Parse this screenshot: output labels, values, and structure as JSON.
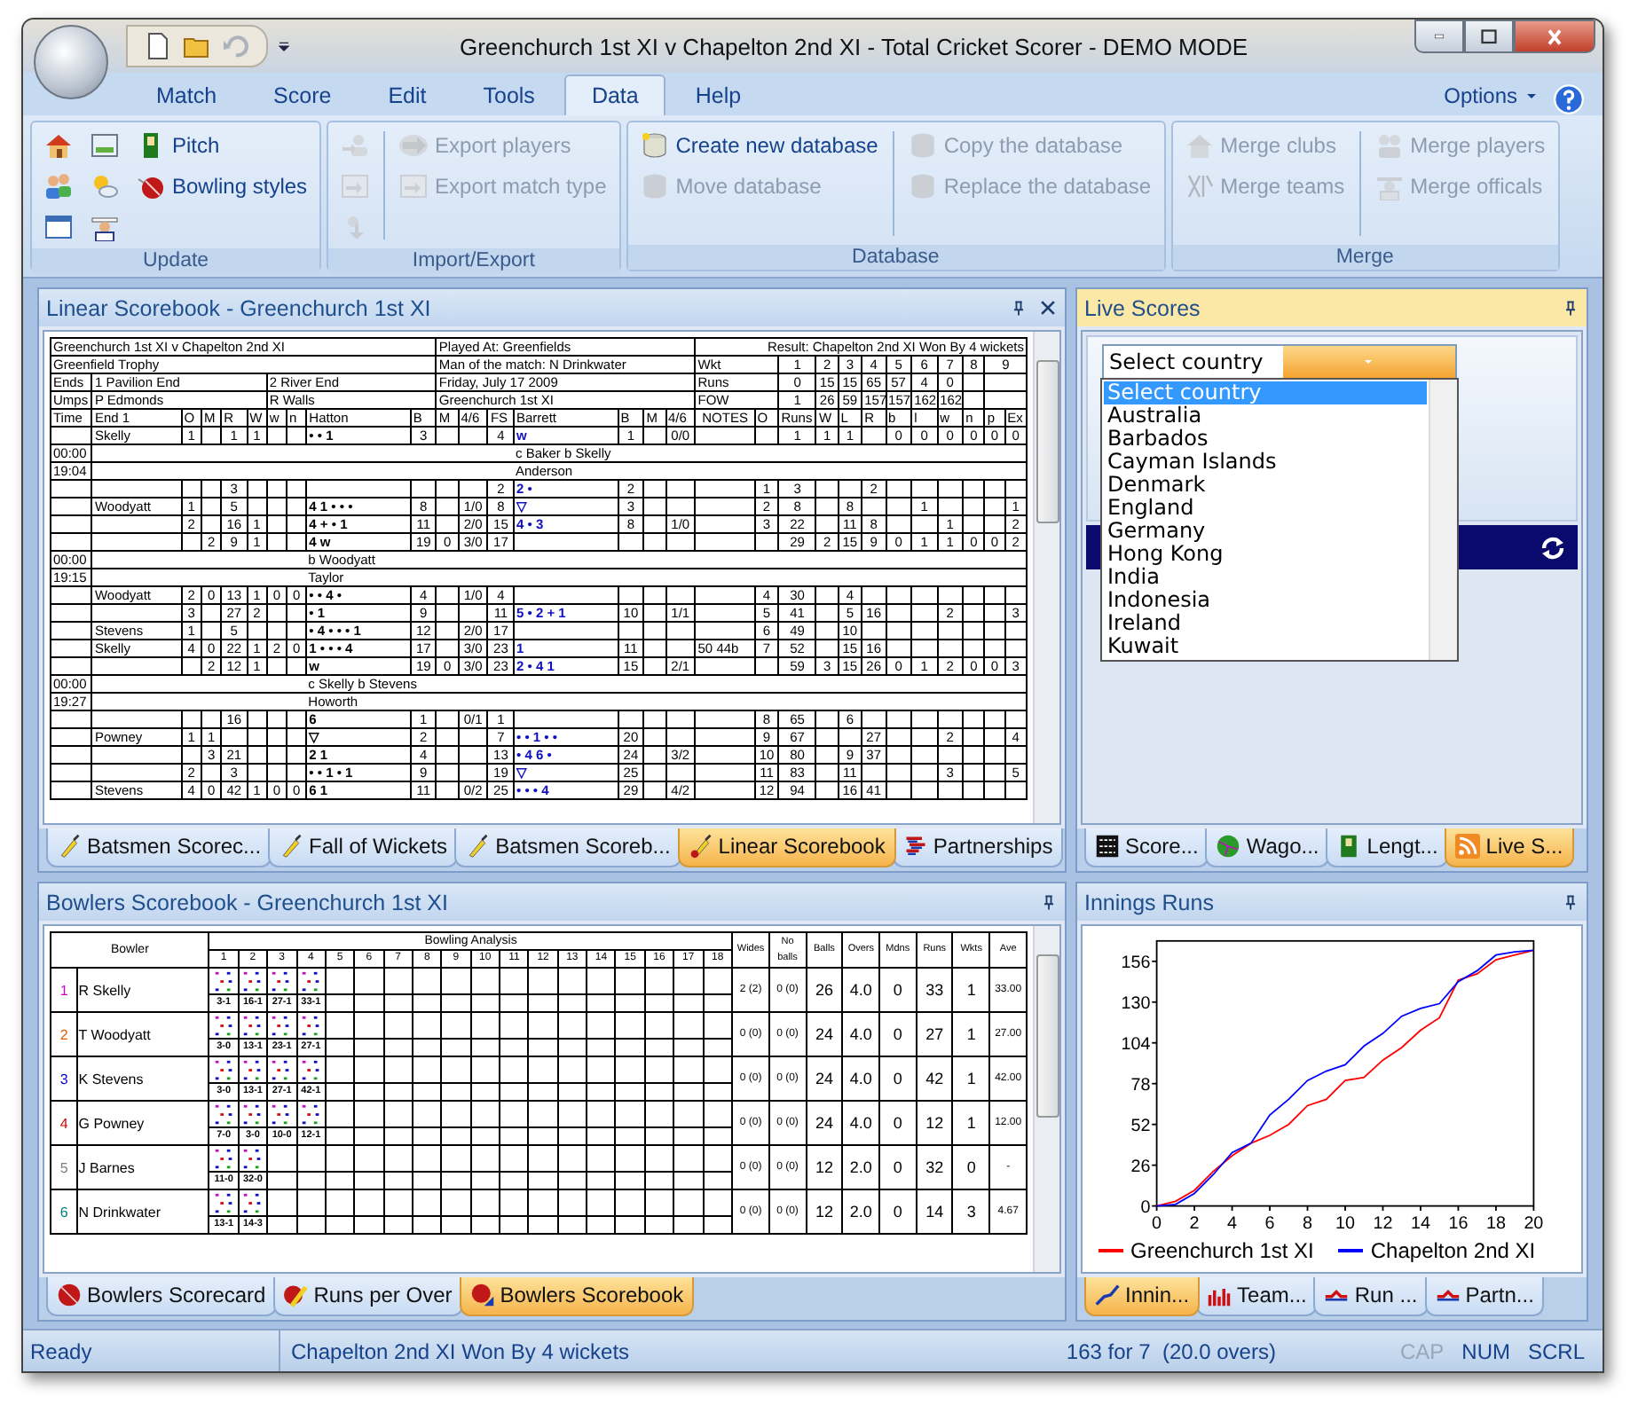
{
  "window": {
    "title": "Greenchurch 1st XI v Chapelton 2nd XI - Total Cricket Scorer - DEMO MODE"
  },
  "quick_access": [
    {
      "disabled": false
    },
    {
      "disabled": false
    },
    {
      "disabled": true
    }
  ],
  "ribbon_tabs": [
    {
      "label": "Match",
      "selected": false
    },
    {
      "label": "Score",
      "selected": false
    },
    {
      "label": "Edit",
      "selected": false
    },
    {
      "label": "Tools",
      "selected": false
    },
    {
      "label": "Data",
      "selected": true
    },
    {
      "label": "Help",
      "selected": false
    }
  ],
  "options": {
    "label": "Options"
  },
  "ribbon_groups": [
    {
      "label": "Update",
      "columns": [
        {
          "divider_before": false,
          "items": [
            {
              "disabled": false
            },
            {
              "disabled": false
            },
            {
              "disabled": false
            }
          ]
        },
        {
          "divider_before": false,
          "items": [
            {
              "disabled": false
            },
            {
              "disabled": false
            },
            {
              "disabled": false
            }
          ]
        },
        {
          "divider_before": false,
          "items": [
            {
              "label": "Pitch",
              "disabled": false
            },
            {
              "label": "Bowling styles",
              "disabled": false
            }
          ]
        }
      ]
    },
    {
      "label": "Import/Export",
      "columns": [
        {
          "divider_before": false,
          "items": [
            {
              "disabled": true
            },
            {
              "disabled": true
            },
            {
              "disabled": true
            }
          ]
        },
        {
          "divider_before": true,
          "items": [
            {
              "label": "Export players",
              "disabled": true
            },
            {
              "label": "Export match type",
              "disabled": true
            }
          ]
        }
      ]
    },
    {
      "label": "Database",
      "columns": [
        {
          "divider_before": false,
          "items": [
            {
              "label": "Create new database",
              "disabled": false
            },
            {
              "label": "Move database",
              "disabled": true
            }
          ]
        },
        {
          "divider_before": true,
          "items": [
            {
              "label": "Copy the database",
              "disabled": true
            },
            {
              "label": "Replace the database",
              "disabled": true
            }
          ]
        }
      ]
    },
    {
      "label": "Merge",
      "columns": [
        {
          "divider_before": false,
          "items": [
            {
              "label": "Merge clubs",
              "disabled": true
            },
            {
              "label": "Merge teams",
              "disabled": true
            }
          ]
        },
        {
          "divider_before": true,
          "items": [
            {
              "label": "Merge players",
              "disabled": true
            },
            {
              "label": "Merge officals",
              "disabled": true
            }
          ]
        }
      ]
    }
  ],
  "linear_scorebook": {
    "title": "Linear Scorebook - Greenchurch 1st XI",
    "info": {
      "match": "Greenchurch 1st XI v Chapelton 2nd XI",
      "played_at": "Played At: Greenfields",
      "result": "Result: Chapelton 2nd XI Won By 4 wickets",
      "competition": "Greenfield Trophy",
      "man_of_match": "Man of the match: N Drinkwater",
      "ends_label": "Ends",
      "end_1": "1 Pavilion End",
      "end_2": "2 River End",
      "date": "Friday, July 17 2009",
      "umps_label": "Umps",
      "ump_1": "P Edmonds",
      "ump_2": "R Walls",
      "batting_team": "Greenchurch 1st XI",
      "fall": [
        {
          "label": "Wkt",
          "values": [
            "1",
            "2",
            "3",
            "4",
            "5",
            "6",
            "7",
            "8",
            "9"
          ]
        },
        {
          "label": "Runs",
          "values": [
            "0",
            "15",
            "15",
            "65",
            "57",
            "4",
            "0"
          ]
        },
        {
          "label": "FOW",
          "values": [
            "1",
            "26",
            "59",
            "157",
            "157",
            "162",
            "162"
          ]
        }
      ]
    },
    "columns": [
      "Time",
      "End 1",
      "O",
      "M",
      "R",
      "W",
      "w",
      "n",
      "Hatton",
      "B",
      "M",
      "4/6",
      "FS",
      "Barrett",
      "B",
      "M",
      "4/6",
      "NOTES",
      "O",
      "Runs",
      "W",
      "L",
      "R",
      "b",
      "l",
      "w",
      "n",
      "p",
      "Ex"
    ],
    "rows": [
      {
        "kind": "over",
        "cells": [
          null,
          "Skelly",
          "1",
          null,
          "1",
          "1",
          null,
          null,
          "• • 1",
          "3",
          null,
          null,
          "4",
          "w",
          "1",
          null,
          "0/0",
          null,
          null,
          "1",
          "1",
          "1",
          null,
          "0",
          "0",
          "0",
          "0",
          "0",
          "0"
        ]
      },
      {
        "kind": "right",
        "time": "00:00",
        "text": "c Baker b Skelly"
      },
      {
        "kind": "right",
        "time": "19:04",
        "text": "Anderson"
      },
      {
        "kind": "over",
        "cells": [
          null,
          null,
          null,
          null,
          "3",
          null,
          null,
          null,
          null,
          null,
          null,
          null,
          "2",
          "2 •",
          "2",
          null,
          null,
          null,
          "1",
          "3",
          null,
          null,
          "2",
          null,
          null,
          null,
          null,
          null,
          null
        ]
      },
      {
        "kind": "over",
        "cells": [
          null,
          "Woodyatt",
          "1",
          null,
          "5",
          null,
          null,
          null,
          "4 1 • • •",
          "8",
          null,
          "1/0",
          "8",
          "▽",
          "3",
          null,
          null,
          null,
          "2",
          "8",
          null,
          "8",
          null,
          null,
          "1",
          null,
          null,
          null,
          "1"
        ]
      },
      {
        "kind": "over",
        "cells": [
          null,
          null,
          "2",
          null,
          "16",
          "1",
          null,
          null,
          "4 + • 1",
          "11",
          null,
          "2/0",
          "15",
          "4 • 3",
          "8",
          null,
          "1/0",
          null,
          "3",
          "22",
          null,
          "11",
          "8",
          null,
          null,
          "1",
          null,
          null,
          "2"
        ]
      },
      {
        "kind": "over",
        "cells": [
          null,
          null,
          null,
          "2",
          "9",
          "1",
          null,
          null,
          "4 w",
          "19",
          "0",
          "3/0",
          "17",
          null,
          null,
          null,
          null,
          null,
          null,
          "29",
          "2",
          "15",
          "9",
          "0",
          "1",
          "1",
          "0",
          "0",
          "2"
        ]
      },
      {
        "kind": "left",
        "time": "00:00",
        "text": "b Woodyatt"
      },
      {
        "kind": "left",
        "time": "19:15",
        "text": "Taylor"
      },
      {
        "kind": "over",
        "cells": [
          null,
          "Woodyatt",
          "2",
          "0",
          "13",
          "1",
          "0",
          "0",
          "• • 4 •",
          "4",
          null,
          "1/0",
          "4",
          null,
          null,
          null,
          null,
          null,
          "4",
          "30",
          null,
          "4",
          null,
          null,
          null,
          null,
          null,
          null,
          null
        ]
      },
      {
        "kind": "over",
        "cells": [
          null,
          null,
          "3",
          null,
          "27",
          "2",
          null,
          null,
          "• 1",
          "9",
          null,
          null,
          "11",
          "5 • 2 + 1",
          "10",
          null,
          "1/1",
          null,
          "5",
          "41",
          null,
          "5",
          "16",
          null,
          null,
          "2",
          null,
          null,
          "3"
        ]
      },
      {
        "kind": "over",
        "cells": [
          null,
          "Stevens",
          "1",
          null,
          "5",
          null,
          null,
          null,
          "• 4 • • • 1",
          "12",
          null,
          "2/0",
          "17",
          null,
          null,
          null,
          null,
          null,
          "6",
          "49",
          null,
          "10",
          null,
          null,
          null,
          null,
          null,
          null,
          null
        ]
      },
      {
        "kind": "over",
        "cells": [
          null,
          "Skelly",
          "4",
          "0",
          "22",
          "1",
          "2",
          "0",
          "1 • • • 4",
          "17",
          null,
          "3/0",
          "23",
          "1",
          "11",
          null,
          null,
          "50 44b",
          "7",
          "52",
          null,
          "15",
          "16",
          null,
          null,
          null,
          null,
          null,
          null
        ]
      },
      {
        "kind": "over",
        "cells": [
          null,
          null,
          null,
          "2",
          "12",
          "1",
          null,
          null,
          "w",
          "19",
          "0",
          "3/0",
          "23",
          "2 • 4 1",
          "15",
          null,
          "2/1",
          null,
          null,
          "59",
          "3",
          "15",
          "26",
          "0",
          "1",
          "2",
          "0",
          "0",
          "3"
        ]
      },
      {
        "kind": "left",
        "time": "00:00",
        "text": "c Skelly b Stevens"
      },
      {
        "kind": "left",
        "time": "19:27",
        "text": "Howorth"
      },
      {
        "kind": "over",
        "cells": [
          null,
          null,
          null,
          null,
          "16",
          null,
          null,
          null,
          "6",
          "1",
          null,
          "0/1",
          "1",
          null,
          null,
          null,
          null,
          null,
          "8",
          "65",
          null,
          "6",
          null,
          null,
          null,
          null,
          null,
          null,
          null
        ]
      },
      {
        "kind": "over",
        "cells": [
          null,
          "Powney",
          "1",
          "1",
          null,
          null,
          null,
          null,
          "▽",
          "2",
          null,
          null,
          "7",
          "• • 1 • •",
          "20",
          null,
          null,
          null,
          "9",
          "67",
          null,
          null,
          "27",
          null,
          null,
          "2",
          null,
          null,
          "4"
        ]
      },
      {
        "kind": "over",
        "cells": [
          null,
          null,
          null,
          "3",
          "21",
          null,
          null,
          null,
          "2 1",
          "4",
          null,
          null,
          "13",
          "• 4 6 •",
          "24",
          null,
          "3/2",
          null,
          "10",
          "80",
          null,
          "9",
          "37",
          null,
          null,
          null,
          null,
          null,
          null
        ]
      },
      {
        "kind": "over",
        "cells": [
          null,
          null,
          "2",
          null,
          "3",
          null,
          null,
          null,
          "• • 1 • 1",
          "9",
          null,
          null,
          "19",
          "▽",
          "25",
          null,
          null,
          null,
          "11",
          "83",
          null,
          "11",
          null,
          null,
          null,
          "3",
          null,
          null,
          "5"
        ]
      },
      {
        "kind": "over",
        "cells": [
          null,
          "Stevens",
          "4",
          "0",
          "42",
          "1",
          "0",
          "0",
          "6 1",
          "11",
          null,
          "0/2",
          "25",
          "• • • 4",
          "29",
          null,
          "4/2",
          null,
          "12",
          "94",
          null,
          "16",
          "41",
          null,
          null,
          null,
          null,
          null,
          null
        ]
      }
    ],
    "tabs": [
      {
        "label": "Batsmen Scorec...",
        "selected": false
      },
      {
        "label": "Fall of Wickets",
        "selected": false
      },
      {
        "label": "Batsmen Scoreb...",
        "selected": false
      },
      {
        "label": "Linear Scorebook",
        "selected": true
      },
      {
        "label": "Partnerships",
        "selected": false
      }
    ]
  },
  "live_scores": {
    "title": "Live Scores",
    "country_select": {
      "value": "Select country",
      "options": [
        {
          "label": "Select country",
          "selected": true
        },
        {
          "label": "Australia",
          "selected": false
        },
        {
          "label": "Barbados",
          "selected": false
        },
        {
          "label": "Cayman Islands",
          "selected": false
        },
        {
          "label": "Denmark",
          "selected": false
        },
        {
          "label": "England",
          "selected": false
        },
        {
          "label": "Germany",
          "selected": false
        },
        {
          "label": "Hong Kong",
          "selected": false
        },
        {
          "label": "India",
          "selected": false
        },
        {
          "label": "Indonesia",
          "selected": false
        },
        {
          "label": "Ireland",
          "selected": false
        },
        {
          "label": "Kuwait",
          "selected": false
        }
      ]
    },
    "tabs": [
      {
        "label": "Score...",
        "selected": false
      },
      {
        "label": "Wago...",
        "selected": false
      },
      {
        "label": "Lengt...",
        "selected": false
      },
      {
        "label": "Live S...",
        "selected": true
      }
    ]
  },
  "bowlers_scorebook": {
    "title": "Bowlers Scorebook - Greenchurch 1st XI",
    "bowler_heading": "Bowler",
    "analysis_heading": "Bowling Analysis",
    "overs": [
      "1",
      "2",
      "3",
      "4",
      "5",
      "6",
      "7",
      "8",
      "9",
      "10",
      "11",
      "12",
      "13",
      "14",
      "15",
      "16",
      "17",
      "18"
    ],
    "stat_headings": [
      "Wides",
      "No balls",
      "Balls",
      "Overs",
      "Mdns",
      "Runs",
      "Wkts",
      "Ave"
    ],
    "bowlers": [
      {
        "number": "1",
        "color": "#cc00cc",
        "name": "R Skelly",
        "over_totals": [
          "3-1",
          "16-1",
          "27-1",
          "33-1"
        ],
        "stats": [
          "2 (2)",
          "0 (0)",
          "26",
          "4.0",
          "0",
          "33",
          "1",
          "33.00"
        ]
      },
      {
        "number": "2",
        "color": "#e06000",
        "name": "T Woodyatt",
        "over_totals": [
          "3-0",
          "13-1",
          "23-1",
          "27-1"
        ],
        "stats": [
          "0 (0)",
          "0 (0)",
          "24",
          "4.0",
          "0",
          "27",
          "1",
          "27.00"
        ]
      },
      {
        "number": "3",
        "color": "#0000cc",
        "name": "K Stevens",
        "over_totals": [
          "3-0",
          "13-1",
          "27-1",
          "42-1"
        ],
        "stats": [
          "0 (0)",
          "0 (0)",
          "24",
          "4.0",
          "0",
          "42",
          "1",
          "42.00"
        ]
      },
      {
        "number": "4",
        "color": "#cc0000",
        "name": "G Powney",
        "over_totals": [
          "7-0",
          "3-0",
          "10-0",
          "12-1"
        ],
        "stats": [
          "0 (0)",
          "0 (0)",
          "24",
          "4.0",
          "0",
          "12",
          "1",
          "12.00"
        ]
      },
      {
        "number": "5",
        "color": "#808080",
        "name": "J Barnes",
        "over_totals": [
          "11-0",
          "32-0"
        ],
        "stats": [
          "0 (0)",
          "0 (0)",
          "12",
          "2.0",
          "0",
          "32",
          "0",
          "-"
        ]
      },
      {
        "number": "6",
        "color": "#008080",
        "name": "N Drinkwater",
        "over_totals": [
          "13-1",
          "14-3"
        ],
        "stats": [
          "0 (0)",
          "0 (0)",
          "12",
          "2.0",
          "0",
          "14",
          "3",
          "4.67"
        ]
      }
    ],
    "tabs": [
      {
        "label": "Bowlers Scorecard",
        "selected": false
      },
      {
        "label": "Runs per Over",
        "selected": false
      },
      {
        "label": "Bowlers Scorebook",
        "selected": true
      }
    ]
  },
  "innings_runs": {
    "title": "Innings Runs",
    "chart_data": {
      "type": "line",
      "x": [
        0,
        1,
        2,
        3,
        4,
        5,
        6,
        7,
        8,
        9,
        10,
        11,
        12,
        13,
        14,
        15,
        16,
        17,
        18,
        19,
        20
      ],
      "xlim": [
        0,
        20
      ],
      "ylim": [
        0,
        169
      ],
      "xticks": [
        0,
        2,
        4,
        6,
        8,
        10,
        12,
        14,
        16,
        18,
        20
      ],
      "yticks": [
        0,
        26,
        52,
        78,
        104,
        130,
        156
      ],
      "legend": "bottom",
      "series": [
        {
          "name": "Greenchurch 1st XI",
          "color": "#ff0000",
          "values": [
            0,
            3,
            10,
            22,
            32,
            40,
            45,
            52,
            64,
            68,
            80,
            82,
            93,
            101,
            112,
            120,
            144,
            148,
            157,
            160,
            163
          ]
        },
        {
          "name": "Chapelton 2nd XI",
          "color": "#0000ff",
          "values": [
            0,
            1,
            8,
            20,
            34,
            40,
            58,
            68,
            80,
            86,
            90,
            102,
            110,
            121,
            126,
            129,
            143,
            150,
            160,
            162,
            163
          ]
        }
      ]
    },
    "tabs": [
      {
        "label": "Innin...",
        "selected": true
      },
      {
        "label": "Team...",
        "selected": false
      },
      {
        "label": "Run ...",
        "selected": false
      },
      {
        "label": "Partn...",
        "selected": false
      }
    ]
  },
  "status_bar": {
    "state": "Ready",
    "result": "Chapelton 2nd XI Won By 4 wickets",
    "score": "163 for 7  (20.0 overs)",
    "keys": [
      {
        "label": "CAP",
        "on": false
      },
      {
        "label": "NUM",
        "on": true
      },
      {
        "label": "SCRL",
        "on": true
      }
    ]
  }
}
